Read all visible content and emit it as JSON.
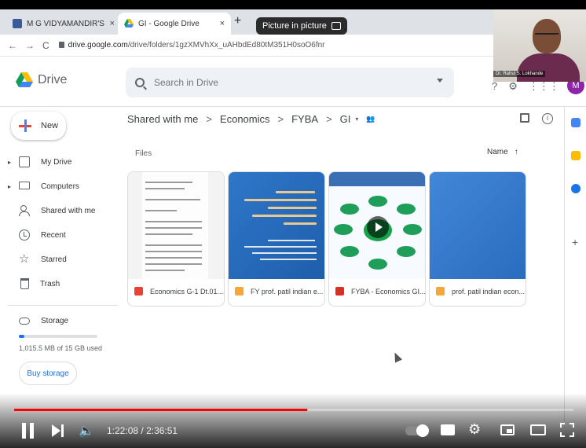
{
  "browser": {
    "tabs": [
      {
        "title": "M G VIDYAMANDIR'S",
        "close": "×"
      },
      {
        "title": "GI - Google Drive",
        "close": "×"
      }
    ],
    "new_tab": "+",
    "pip_label": "Picture in picture",
    "url_domain": "drive.google.com",
    "url_path": "/drive/folders/1gzXMVhXx_uAHbdEd80tM351H0soO6fnr",
    "nav": {
      "back": "←",
      "forward": "→",
      "reload": "C"
    }
  },
  "webcam": {
    "label": "Dr. Rahul S. Lokhande"
  },
  "drive": {
    "logo_text": "Drive",
    "search_placeholder": "Search in Drive",
    "avatar_letter": "M",
    "header_icons": {
      "help": "?",
      "settings": "⚙",
      "apps": "⋮⋮⋮"
    }
  },
  "sidebar": {
    "new_label": "New",
    "items": [
      {
        "label": "My Drive",
        "arrow": "▸"
      },
      {
        "label": "Computers",
        "arrow": "▸"
      },
      {
        "label": "Shared with me"
      },
      {
        "label": "Recent"
      },
      {
        "label": "Starred",
        "star": "☆"
      },
      {
        "label": "Trash"
      }
    ],
    "storage": {
      "label": "Storage",
      "used_text": "1,015.5 MB of 15 GB used",
      "used_fraction": 0.066,
      "buy_label": "Buy storage"
    }
  },
  "main": {
    "breadcrumb": [
      "Shared with me",
      "Economics",
      "FYBA",
      "GI"
    ],
    "breadcrumb_sep": ">",
    "breadcrumb_caret": "▾",
    "shared_glyph": "👥",
    "files_label": "Files",
    "sort_label": "Name",
    "sort_arrow": "↑",
    "info_glyph": "i",
    "files": [
      {
        "name": "Economics G-1 Dt.01....",
        "type": "pdf"
      },
      {
        "name": "FY prof. patil indian e...",
        "type": "ppt"
      },
      {
        "name": "FYBA - Economics GI....",
        "type": "video"
      },
      {
        "name": "prof. patil indian econ...",
        "type": "ppt"
      }
    ],
    "right_panel_plus": "+"
  },
  "video": {
    "current_time": "1:22:08",
    "duration": "2:36:51",
    "time_sep": " / ",
    "progress_fraction": 0.524,
    "volume_glyph": "🔈",
    "settings_glyph": "⚙"
  },
  "colors": {
    "progress": "#ff0000",
    "drive_blue": "#1a73e8",
    "search_bg": "#eef1f6",
    "avatar_bg": "#8e24aa"
  }
}
